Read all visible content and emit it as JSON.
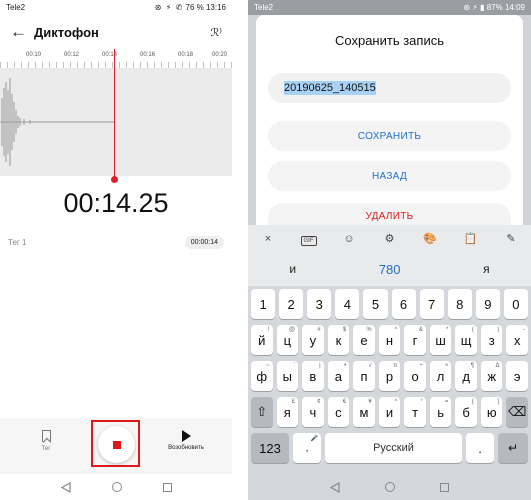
{
  "left": {
    "status": {
      "carrier": "Tele2",
      "icons": "⊛ ⚡ ✆",
      "battery_text": "76 %",
      "time": "13:16"
    },
    "header": {
      "title": "Диктофон",
      "back_icon": "back-arrow-icon",
      "mode_icon": "voice-mode-icon"
    },
    "timeline": {
      "labels": [
        "00:10",
        "00:12",
        "00:14",
        "00:16",
        "00:18",
        "00:20"
      ]
    },
    "timer": "00:14.25",
    "tag_row": {
      "label": "Тег 1",
      "time": "00:00:14"
    },
    "bottom": {
      "tag_label": "Тег",
      "resume_label": "Возобновить"
    },
    "colors": {
      "accent": "#e0202a"
    }
  },
  "right": {
    "status": {
      "carrier": "Tele2",
      "battery_text": "87%",
      "time": "14:09"
    },
    "dialog": {
      "title": "Сохранить запись",
      "filename": "20190625_140515",
      "save_label": "СОХРАНИТЬ",
      "back_label": "НАЗАД",
      "delete_label": "УДАЛИТЬ"
    },
    "keyboard": {
      "tools": [
        "×",
        "GIF",
        "☺",
        "⚙",
        "🎨",
        "📋",
        "✎"
      ],
      "suggestions": [
        "и",
        "780",
        "я"
      ],
      "num_row": [
        "1",
        "2",
        "3",
        "4",
        "5",
        "6",
        "7",
        "8",
        "9",
        "0"
      ],
      "row1": [
        [
          "й",
          "!"
        ],
        [
          "ц",
          "@"
        ],
        [
          "у",
          "#"
        ],
        [
          "к",
          "$"
        ],
        [
          "е",
          "%"
        ],
        [
          "н",
          "^"
        ],
        [
          "г",
          "&"
        ],
        [
          "ш",
          "*"
        ],
        [
          "щ",
          "("
        ],
        [
          "з",
          ")"
        ],
        [
          "х",
          "-"
        ]
      ],
      "row2": [
        [
          "ф",
          "~"
        ],
        [
          "ы",
          "`"
        ],
        [
          "в",
          "|"
        ],
        [
          "а",
          "•"
        ],
        [
          "п",
          "√"
        ],
        [
          "р",
          "π"
        ],
        [
          "о",
          "÷"
        ],
        [
          "л",
          "×"
        ],
        [
          "д",
          "¶"
        ],
        [
          "ж",
          "Δ"
        ],
        [
          "э",
          ""
        ]
      ],
      "row3": [
        [
          "⇧",
          ""
        ],
        [
          "я",
          "£"
        ],
        [
          "ч",
          "¢"
        ],
        [
          "с",
          "€"
        ],
        [
          "м",
          "¥"
        ],
        [
          "и",
          "^"
        ],
        [
          "т",
          "°"
        ],
        [
          "ь",
          "="
        ],
        [
          "б",
          "{"
        ],
        [
          "ю",
          "}"
        ],
        [
          "⌫",
          ""
        ]
      ],
      "k123": "123",
      "space": "Русский",
      "comma": ",",
      "dot": ".",
      "enter": "↵"
    }
  }
}
